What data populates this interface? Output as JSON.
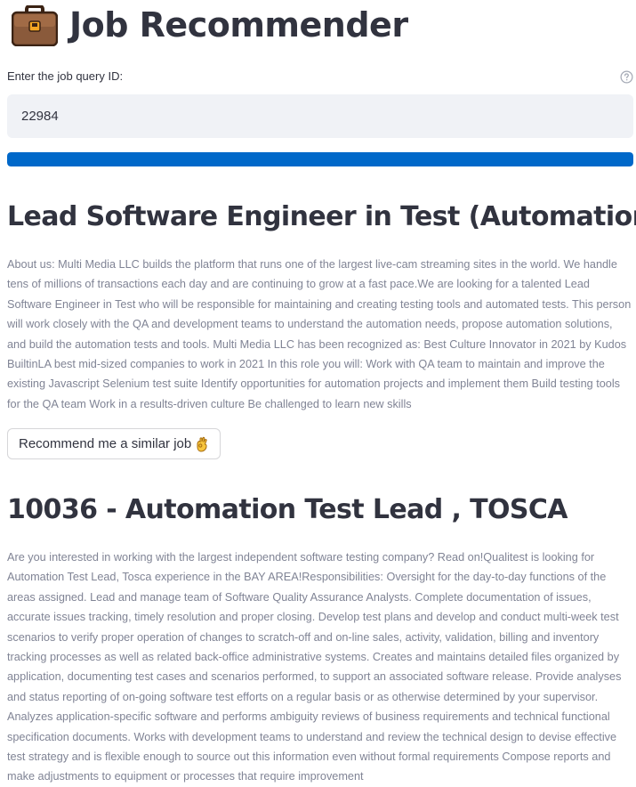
{
  "header": {
    "icon": "briefcase-icon",
    "title": "Job Recommender"
  },
  "query": {
    "label": "Enter the job query ID:",
    "value": "22984",
    "help_icon": "help-circle-icon"
  },
  "progress": {
    "fraction": 1.0,
    "color": "#0068c9"
  },
  "query_job": {
    "title": "Lead Software Engineer in Test (Automation)",
    "description": "About us: Multi Media LLC builds the platform that runs one of the largest live-cam streaming sites in the world. We handle tens of millions of transactions each day and are continuing to grow at a fast pace.We are looking for a talented Lead Software Engineer in Test who will be responsible for maintaining and creating testing tools and automated tests. This person will work closely with the QA and development teams to understand the automation needs, propose automation solutions, and build the automation tests and tools. Multi Media LLC has been recognized as: Best Culture Innovator in 2021 by Kudos BuiltinLA best mid-sized companies to work in 2021 In this role you will: Work with QA team to maintain and improve the existing Javascript Selenium test suite Identify opportunities for automation projects and implement them Build testing tools for the QA team Work in a results-driven culture Be challenged to learn new skills"
  },
  "recommend_button": {
    "label": "Recommend me a similar job",
    "icon": "ok-hand-icon"
  },
  "recommended_job": {
    "title": "10036 - Automation Test Lead , TOSCA",
    "description": "Are you interested in working with the largest independent software testing company? Read on!Qualitest is looking for Automation Test Lead, Tosca experience in the BAY AREA!Responsibilities: Oversight for the day-to-day functions of the areas assigned. Lead and manage team of Software Quality Assurance Analysts. Complete documentation of issues, accurate issues tracking, timely resolution and proper closing. Develop test plans and develop and conduct multi-week test scenarios to verify proper operation of changes to scratch-off and on-line sales, activity, validation, billing and inventory tracking processes as well as related back-office administrative systems. Creates and maintains detailed files organized by application, documenting test cases and scenarios performed, to support an associated software release. Provide analyses and status reporting of on-going software test efforts on a regular basis or as otherwise determined by your supervisor. Analyzes application-specific software and performs ambiguity reviews of business requirements and technical functional specification documents. Works with development teams to understand and review the technical design to devise effective test strategy and is flexible enough to source out this information even without formal requirements Compose reports and make adjustments to equipment or processes that require improvement"
  },
  "colors": {
    "text": "#31333f",
    "muted_text": "#808495",
    "input_bg": "#f0f2f6",
    "accent": "#0068c9"
  }
}
